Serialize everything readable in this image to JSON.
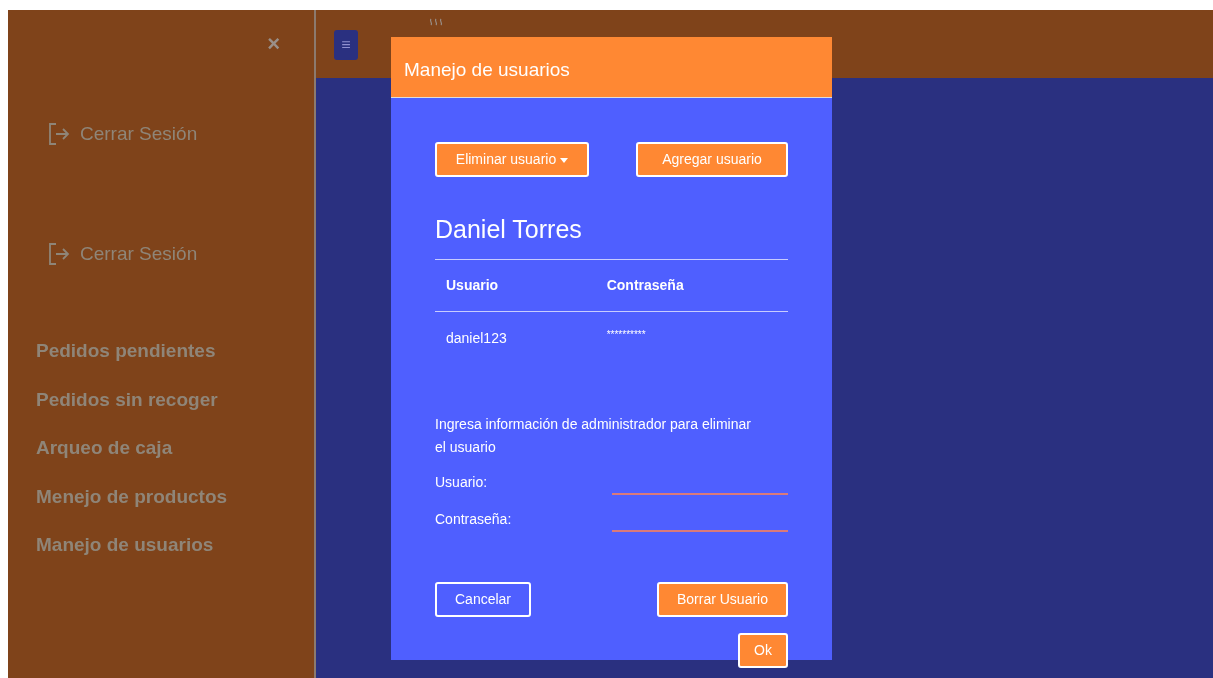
{
  "sidebar": {
    "close": "×",
    "logout_links": [
      "Cerrar Sesión",
      "Cerrar Sesión"
    ],
    "items": [
      "Pedidos pendientes",
      "Pedidos sin recoger",
      "Arqueo de caja",
      "Menejo de productos",
      "Manejo de usuarios"
    ]
  },
  "topbar": {
    "menu_button": "≡"
  },
  "modal": {
    "title": "Manejo de usuarios",
    "actions": [
      {
        "label": "Eliminar usuario",
        "kind": "dropdown"
      },
      {
        "label": "Agregar usuario",
        "kind": "button"
      }
    ],
    "user_name": "Daniel Torres",
    "table": {
      "columns": [
        "Usuario",
        "Contraseña"
      ],
      "rows": [
        [
          "daniel123",
          "**********"
        ]
      ]
    },
    "instructions": "Ingresa información de administrador para eliminar el usuario",
    "fields": [
      {
        "label": "Usuario:"
      },
      {
        "label": "Contraseña:"
      }
    ],
    "buttons": [
      {
        "label": "Cancelar",
        "kind": "outline"
      },
      {
        "label": "Borrar Usuario",
        "kind": "primary"
      }
    ],
    "ok": "Ok"
  }
}
